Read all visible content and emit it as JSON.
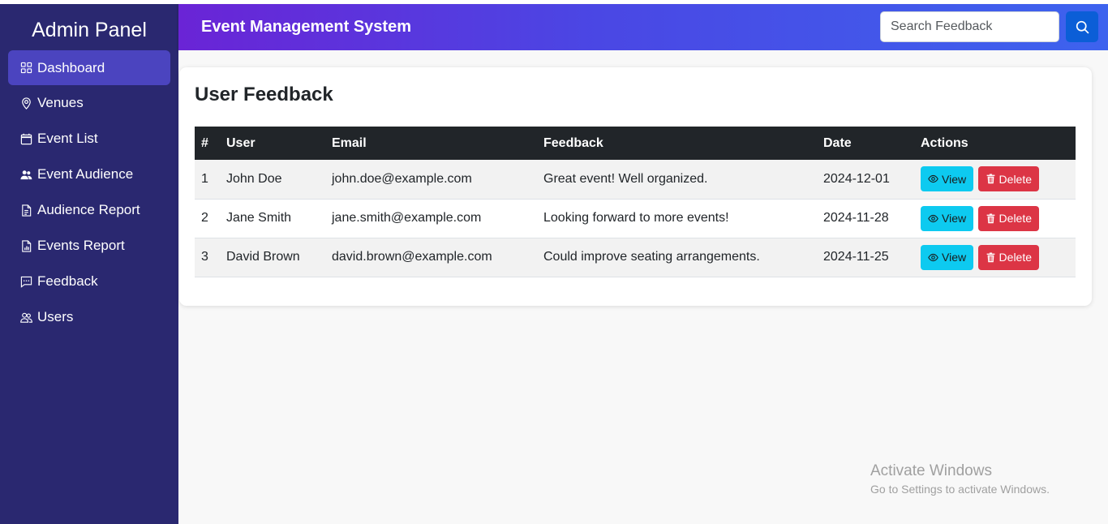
{
  "sidebar": {
    "title": "Admin Panel",
    "items": [
      {
        "label": "Dashboard",
        "icon": "grid-icon",
        "active": true
      },
      {
        "label": "Venues",
        "icon": "map-pin-icon"
      },
      {
        "label": "Event List",
        "icon": "calendar-icon"
      },
      {
        "label": "Event Audience",
        "icon": "people-icon"
      },
      {
        "label": "Audience Report",
        "icon": "document-icon"
      },
      {
        "label": "Events Report",
        "icon": "bar-chart-file-icon"
      },
      {
        "label": "Feedback",
        "icon": "chat-dots-icon"
      },
      {
        "label": "Users",
        "icon": "users-icon"
      }
    ]
  },
  "header": {
    "title": "Event Management System",
    "search_placeholder": "Search Feedback",
    "search_icon": "search-icon"
  },
  "main": {
    "title": "User Feedback",
    "columns": [
      "#",
      "User",
      "Email",
      "Feedback",
      "Date",
      "Actions"
    ],
    "rows": [
      {
        "num": "1",
        "user": "John Doe",
        "email": "john.doe@example.com",
        "feedback": "Great event! Well organized.",
        "date": "2024-12-01"
      },
      {
        "num": "2",
        "user": "Jane Smith",
        "email": "jane.smith@example.com",
        "feedback": "Looking forward to more events!",
        "date": "2024-11-28"
      },
      {
        "num": "3",
        "user": "David Brown",
        "email": "david.brown@example.com",
        "feedback": "Could improve seating arrangements.",
        "date": "2024-11-25"
      }
    ],
    "view_label": "View",
    "delete_label": "Delete"
  },
  "watermark": {
    "title": "Activate Windows",
    "subtitle": "Go to Settings to activate Windows."
  },
  "colors": {
    "sidebar_bg": "#2a2870",
    "active_item": "#4b44bf",
    "header_gradient_start": "#6a24d6",
    "header_gradient_end": "#3d63ee",
    "view_button": "#0dcaf0",
    "delete_button": "#dc3545",
    "search_button": "#0b5ed7"
  }
}
